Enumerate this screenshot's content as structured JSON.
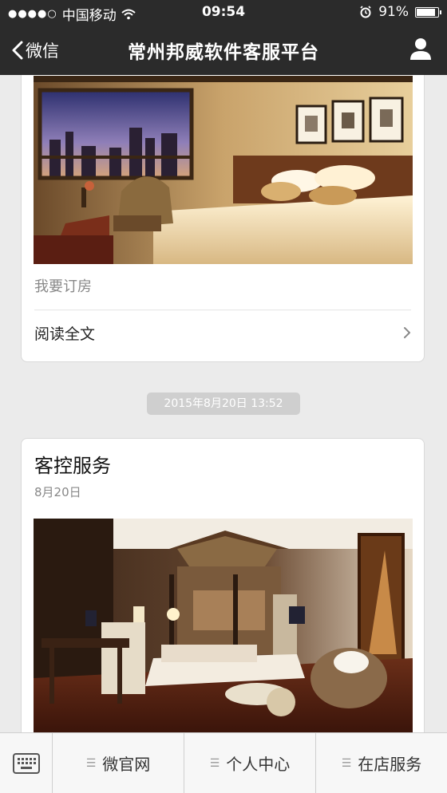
{
  "status_bar": {
    "carrier": "中国移动",
    "time": "09:54",
    "battery": "91%",
    "battery_level": 0.91
  },
  "nav": {
    "back_label": "微信",
    "title": "常州邦威软件客服平台"
  },
  "article1": {
    "description": "我要订房",
    "read_more": "阅读全文"
  },
  "timestamp": "2015年8月20日 13:52",
  "article2": {
    "title": "客控服务",
    "date": "8月20日"
  },
  "tabbar": {
    "menus": [
      {
        "label": "微官网"
      },
      {
        "label": "个人中心"
      },
      {
        "label": "在店服务"
      }
    ]
  },
  "icons": {
    "signal": "signal-dots-icon",
    "wifi": "wifi-icon",
    "alarm": "alarm-icon",
    "back": "chevron-left-icon",
    "user": "user-icon",
    "chevron": "chevron-right-icon",
    "keyboard": "keyboard-icon",
    "menu": "menu-lines-icon"
  },
  "colors": {
    "nav_bg": "#2b2b2b",
    "page_bg": "#ebebeb",
    "timestamp_bg": "#cfcfcf"
  }
}
